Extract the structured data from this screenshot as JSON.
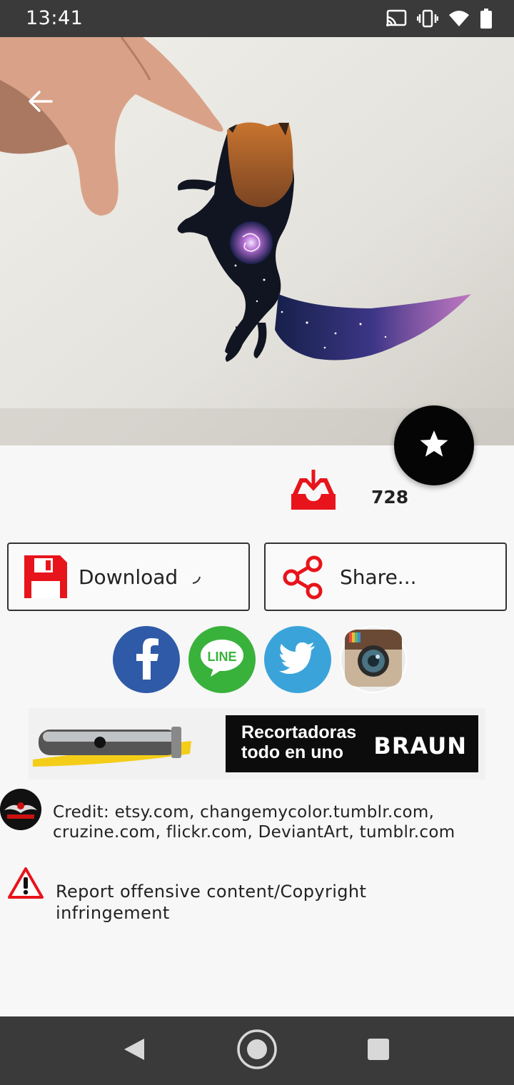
{
  "status_bar": {
    "time": "13:41",
    "icons": [
      "cast-icon",
      "vibrate-icon",
      "wifi-icon",
      "battery-icon"
    ]
  },
  "hero": {
    "back_icon": "arrow-left-icon",
    "favorite_icon": "star-icon"
  },
  "downloads": {
    "icon": "download-tray-icon",
    "count": "728",
    "accent_color": "#e8141b"
  },
  "actions": {
    "download_label": "Download",
    "download_icon": "floppy-disk-icon",
    "share_label": "Share...",
    "share_icon": "share-icon"
  },
  "social": [
    "facebook-icon",
    "line-icon",
    "twitter-icon",
    "instagram-icon"
  ],
  "social_labels": {
    "line": "LINE"
  },
  "ad": {
    "text": "Recortadoras\ntodo en uno",
    "brand": "BRAUN"
  },
  "credit": {
    "text": "Credit: etsy.com, changemycolor.tumblr.com, cruzine.com, flickr.com, DeviantArt, tumblr.com"
  },
  "report": {
    "text": "Report offensive content/Copyright infringement",
    "icon": "warning-icon"
  },
  "nav_bar": {
    "icons": [
      "nav-back-icon",
      "nav-home-icon",
      "nav-recents-icon"
    ]
  }
}
